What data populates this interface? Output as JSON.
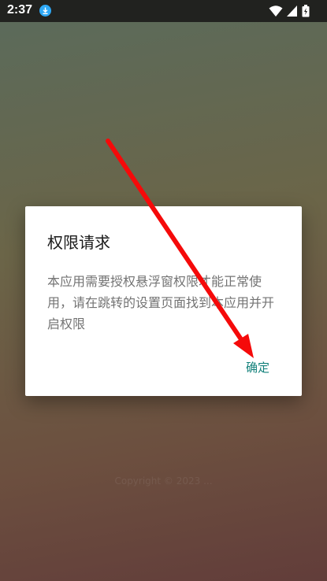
{
  "status_bar": {
    "time": "2:37",
    "icons": [
      "download-icon",
      "wifi-icon",
      "signal-icon",
      "battery-icon"
    ]
  },
  "background": {
    "copyright_text": "Copyright © 2023 ..."
  },
  "dialog": {
    "title": "权限请求",
    "message": "本应用需要授权悬浮窗权限才能正常使用，请在跳转的设置页面找到本应用并开启权限",
    "confirm_label": "确定",
    "accent_color": "#11807a"
  },
  "overlay": {
    "annotation_color": "#f50a0a",
    "annotation": "red-arrow pointing to confirm button"
  }
}
